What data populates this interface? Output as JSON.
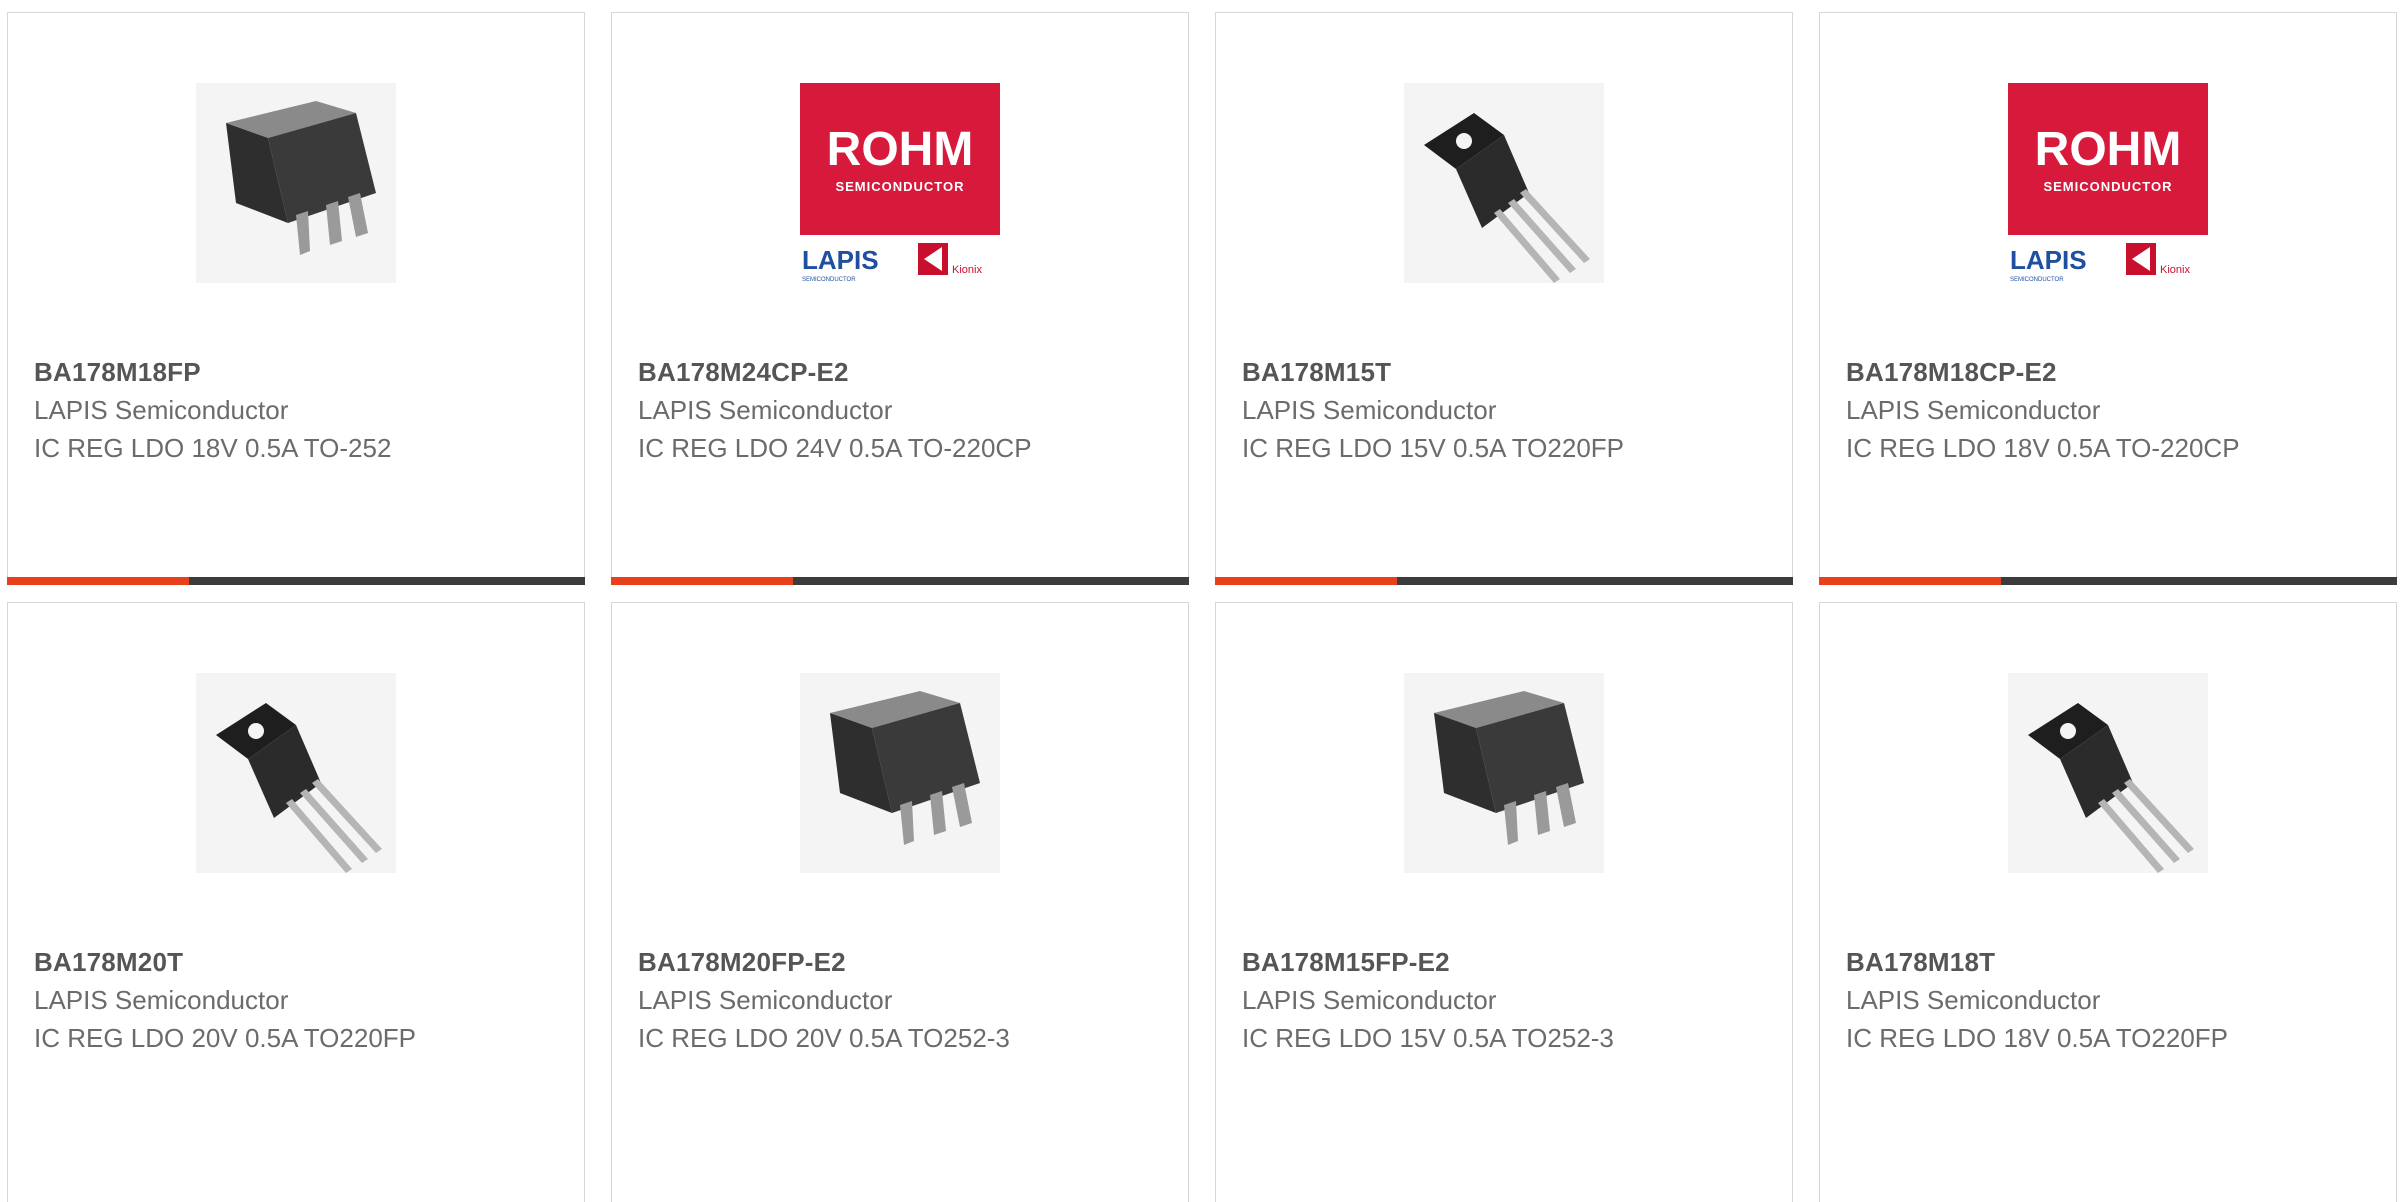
{
  "products": [
    {
      "part_number": "BA178M18FP",
      "manufacturer": "LAPIS Semiconductor",
      "description": "IC REG LDO 18V 0.5A TO-252",
      "image": "to252-package"
    },
    {
      "part_number": "BA178M24CP-E2",
      "manufacturer": "LAPIS Semiconductor",
      "description": "IC REG LDO 24V 0.5A TO-220CP",
      "image": "rohm-logo",
      "logo": {
        "brand": "ROHM",
        "tagline": "SEMICONDUCTOR",
        "sub_brand_1": "LAPIS",
        "sub_brand_1_tagline": "SEMICONDUCTOR",
        "sub_brand_2": "Kionix"
      }
    },
    {
      "part_number": "BA178M15T",
      "manufacturer": "LAPIS Semiconductor",
      "description": "IC REG LDO 15V 0.5A TO220FP",
      "image": "to220-package"
    },
    {
      "part_number": "BA178M18CP-E2",
      "manufacturer": "LAPIS Semiconductor",
      "description": "IC REG LDO 18V 0.5A TO-220CP",
      "image": "rohm-logo",
      "logo": {
        "brand": "ROHM",
        "tagline": "SEMICONDUCTOR",
        "sub_brand_1": "LAPIS",
        "sub_brand_1_tagline": "SEMICONDUCTOR",
        "sub_brand_2": "Kionix"
      }
    },
    {
      "part_number": "BA178M20T",
      "manufacturer": "LAPIS Semiconductor",
      "description": "IC REG LDO 20V 0.5A TO220FP",
      "image": "to220-package"
    },
    {
      "part_number": "BA178M20FP-E2",
      "manufacturer": "LAPIS Semiconductor",
      "description": "IC REG LDO 20V 0.5A TO252-3",
      "image": "to252-package"
    },
    {
      "part_number": "BA178M15FP-E2",
      "manufacturer": "LAPIS Semiconductor",
      "description": "IC REG LDO 15V 0.5A TO252-3",
      "image": "to252-package"
    },
    {
      "part_number": "BA178M18T",
      "manufacturer": "LAPIS Semiconductor",
      "description": "IC REG LDO 18V 0.5A TO220FP",
      "image": "to220-package"
    }
  ],
  "colors": {
    "accent": "#e8401a",
    "bar": "#3c3c3c",
    "rohm_red": "#d71a3b",
    "lapis_blue": "#1f4fa0",
    "kionix_red": "#c8102e"
  }
}
